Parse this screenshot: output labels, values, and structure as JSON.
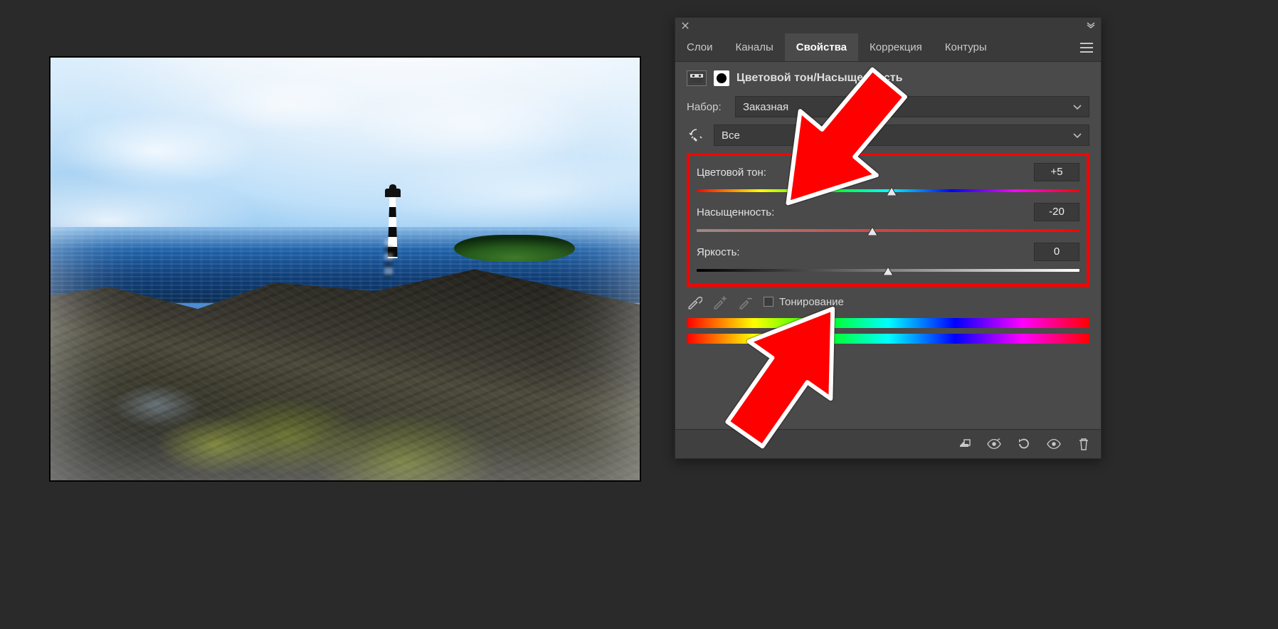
{
  "tabs": {
    "layers": "Слои",
    "channels": "Каналы",
    "properties": "Свойства",
    "adjustments": "Коррекция",
    "paths": "Контуры"
  },
  "panel": {
    "title": "Цветовой тон/Насыщенность",
    "preset_label": "Набор:",
    "preset_value": "Заказная",
    "range_value": "Все"
  },
  "sliders": {
    "hue": {
      "label": "Цветовой тон:",
      "value": "+5",
      "pos": 51
    },
    "sat": {
      "label": "Насыщенность:",
      "value": "-20",
      "pos": 46
    },
    "light": {
      "label": "Яркость:",
      "value": "0",
      "pos": 50
    }
  },
  "colorize_label": "Тонирование"
}
